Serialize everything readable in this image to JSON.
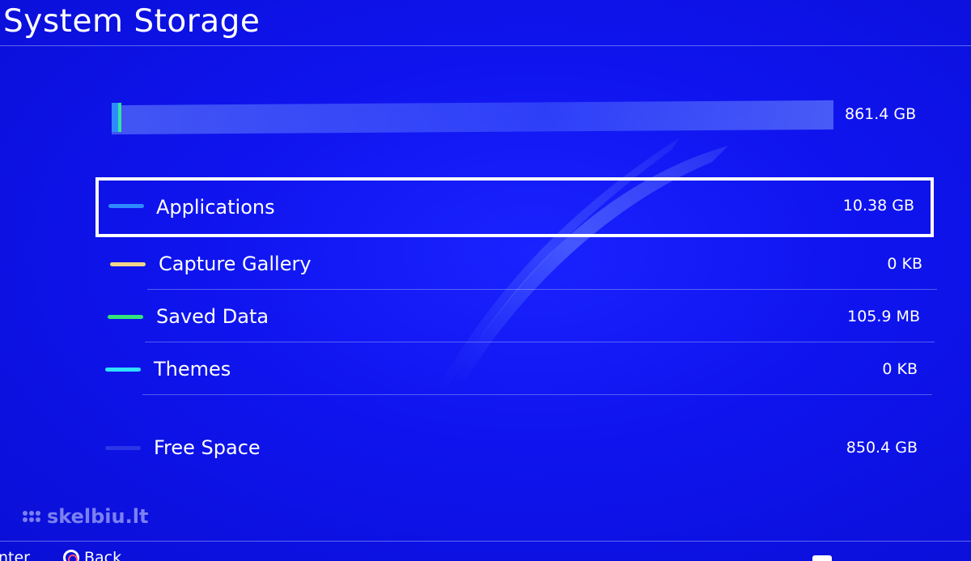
{
  "header": {
    "title": "System Storage"
  },
  "storage": {
    "total_label": "861.4 GB",
    "used_fraction": 0.013
  },
  "categories": [
    {
      "label": "Applications",
      "value": "10.38 GB",
      "color": "#2e8bff",
      "selected": true
    },
    {
      "label": "Capture Gallery",
      "value": "0 KB",
      "color": "#f2d58a",
      "selected": false
    },
    {
      "label": "Saved Data",
      "value": "105.9 MB",
      "color": "#33e57a",
      "selected": false
    },
    {
      "label": "Themes",
      "value": "0 KB",
      "color": "#2fe0ff",
      "selected": false
    },
    {
      "label": "Free Space",
      "value": "850.4 GB",
      "color": "#2a36e8",
      "selected": false
    }
  ],
  "footer": {
    "enter_label": "Enter",
    "back_label": "Back"
  },
  "watermark": {
    "text": "skelbiu.lt"
  },
  "colors": {
    "background": "#0f14ee",
    "text": "#ffffff",
    "selection_border": "#ffffff"
  }
}
